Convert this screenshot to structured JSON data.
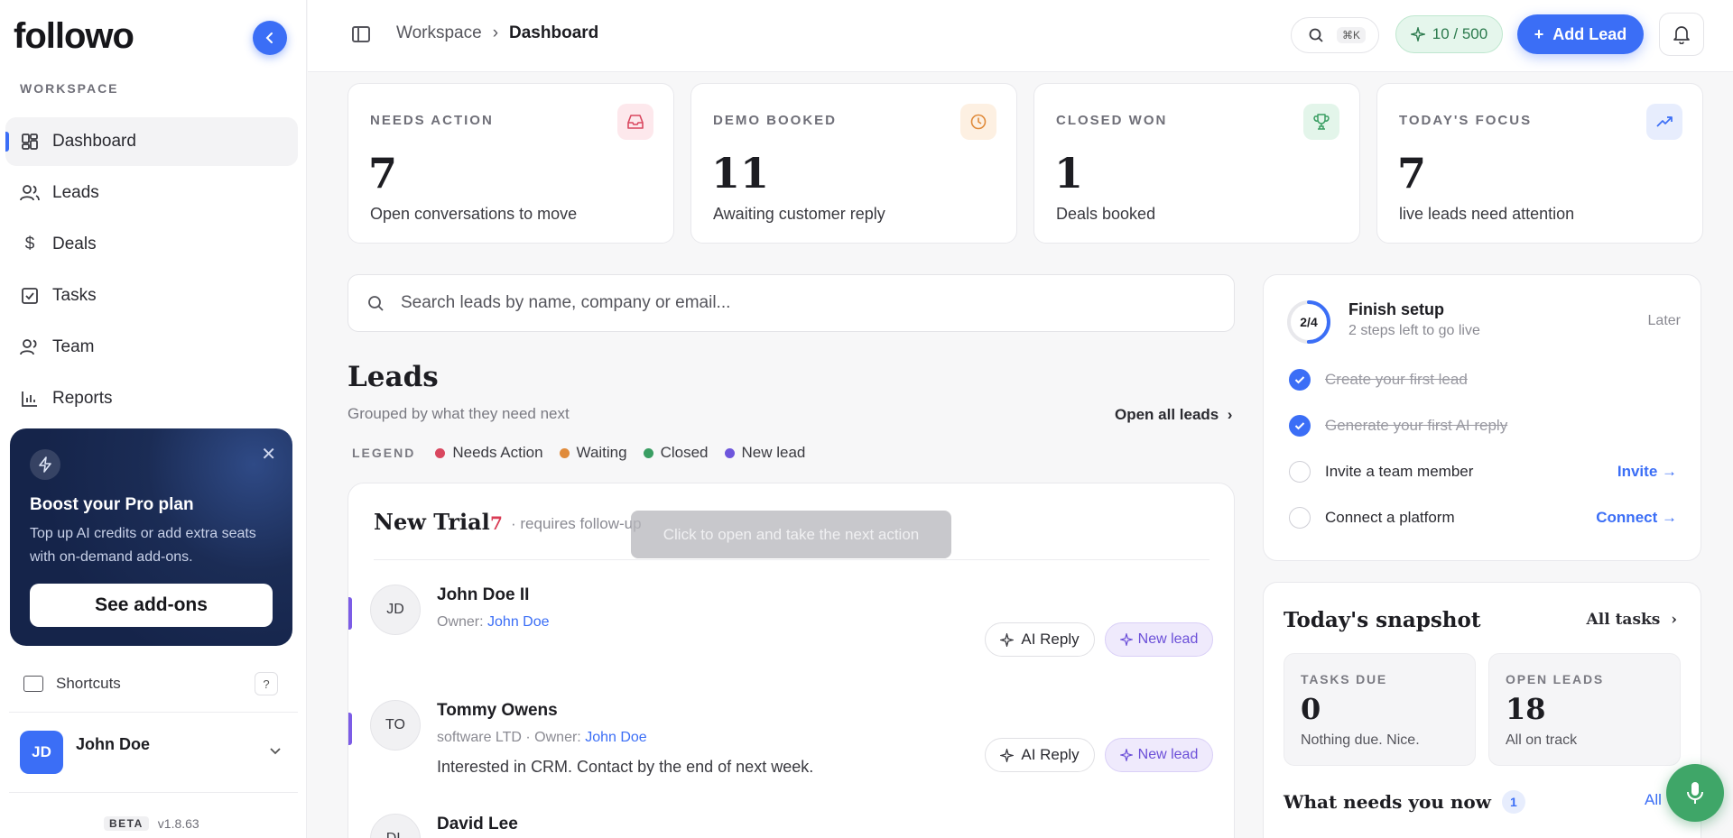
{
  "app": {
    "logo": "followo",
    "logo_dot": "."
  },
  "sidebar": {
    "section": "WORKSPACE",
    "items": [
      {
        "label": "Dashboard",
        "icon": "grid-icon"
      },
      {
        "label": "Leads",
        "icon": "users-icon"
      },
      {
        "label": "Deals",
        "icon": "dollar-icon"
      },
      {
        "label": "Tasks",
        "icon": "checklist-icon"
      },
      {
        "label": "Team",
        "icon": "team-icon"
      },
      {
        "label": "Reports",
        "icon": "bar-chart-icon"
      }
    ],
    "promo": {
      "title": "Boost your Pro plan",
      "text": "Top up AI credits or add extra seats with on-demand add-ons.",
      "button": "See add-ons"
    },
    "shortcuts": {
      "label": "Shortcuts",
      "key": "?"
    },
    "user": {
      "initials": "JD",
      "name": "John Doe"
    },
    "version": {
      "badge": "BETA",
      "number": "v1.8.63"
    }
  },
  "topbar": {
    "crumbs": [
      "Workspace",
      "Dashboard"
    ],
    "search_kbd": "⌘K",
    "credits": "10 / 500",
    "add_lead": "Add Lead"
  },
  "stats": [
    {
      "label": "NEEDS ACTION",
      "value": "7",
      "sub": "Open conversations to move",
      "icon": "inbox-icon",
      "color": "#fde8ec"
    },
    {
      "label": "DEMO BOOKED",
      "value": "11",
      "sub": "Awaiting customer reply",
      "icon": "clock-icon",
      "color": "#fdf0e2"
    },
    {
      "label": "CLOSED WON",
      "value": "1",
      "sub": "Deals booked",
      "icon": "trophy-icon",
      "color": "#e3f5ea"
    },
    {
      "label": "TODAY'S FOCUS",
      "value": "7",
      "sub": "live leads need attention",
      "icon": "trend-up-icon",
      "color": "#e7edfd"
    }
  ],
  "search": {
    "placeholder": "Search leads by name, company or email..."
  },
  "leads": {
    "title": "Leads",
    "subtitle": "Grouped by what they need next",
    "open_all": "Open all leads",
    "legend_title": "LEGEND",
    "legend": [
      {
        "label": "Needs Action",
        "color": "#d9475f"
      },
      {
        "label": "Waiting",
        "color": "#e08b3b"
      },
      {
        "label": "Closed",
        "color": "#3a9e63"
      },
      {
        "label": "New lead",
        "color": "#6e56dc"
      }
    ],
    "group": {
      "title": "New Trial",
      "count": "7",
      "note": "· requires follow-up",
      "tooltip": "Click to open and take the next action",
      "rows": [
        {
          "initials": "JD",
          "name": "John Doe II",
          "meta_prefix": "Owner: ",
          "owner": "John Doe",
          "message": "",
          "ai": "AI Reply",
          "tag": "New lead"
        },
        {
          "initials": "TO",
          "name": "Tommy Owens",
          "meta_prefix": "software LTD · Owner: ",
          "owner": "John Doe",
          "message": "Interested in CRM. Contact by the end of next week.",
          "ai": "AI Reply",
          "tag": "New lead"
        },
        {
          "initials": "DL",
          "name": "David Lee"
        }
      ]
    }
  },
  "setup": {
    "progress": "2/4",
    "progress_fraction": 0.5,
    "title": "Finish setup",
    "subtitle": "2 steps left to go live",
    "later": "Later",
    "steps": [
      {
        "label": "Create your first lead",
        "done": true
      },
      {
        "label": "Generate your first AI reply",
        "done": true
      },
      {
        "label": "Invite a team member",
        "done": false,
        "action": "Invite →"
      },
      {
        "label": "Connect a platform",
        "done": false,
        "action": "Connect →"
      }
    ]
  },
  "snapshot": {
    "title": "Today's snapshot",
    "all_tasks": "All tasks",
    "tasks_due": {
      "label": "TASKS DUE",
      "value": "0",
      "sub": "Nothing due. Nice."
    },
    "open_leads": {
      "label": "OPEN LEADS",
      "value": "18",
      "sub": "All on track"
    },
    "needs_title": "What needs you now",
    "needs_count": "1",
    "needs_all": "All"
  }
}
